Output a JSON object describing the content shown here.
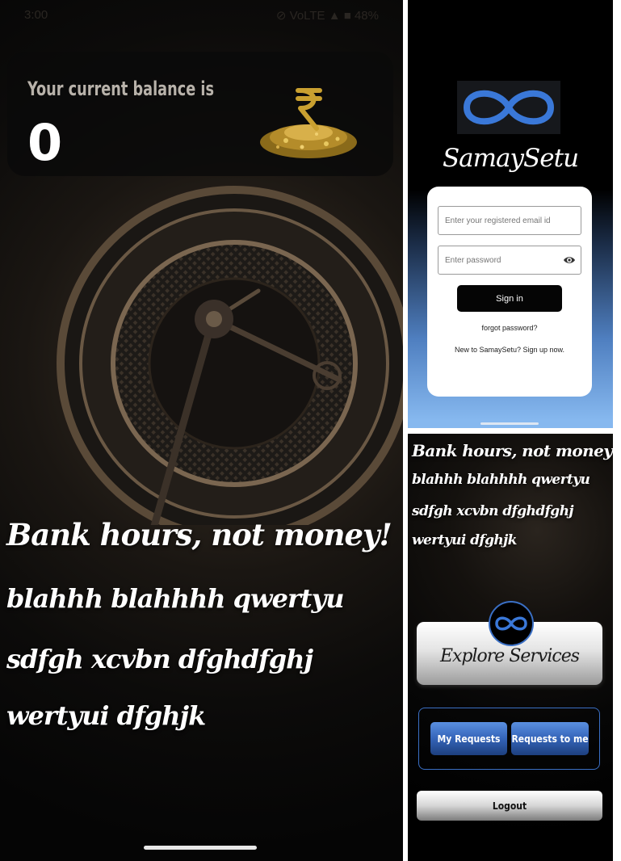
{
  "status_bar": {
    "time": "3:00",
    "indicators": "⊘ VoLTE ▲ ■ 48%"
  },
  "balance_screen": {
    "balance_label": "Your current balance is",
    "balance_value": "0",
    "tagline": [
      "Bank hours, not money!",
      "blahhh blahhhh qwertyu",
      "sdfgh xcvbn dfghdfghj",
      "wertyui dfghjk"
    ]
  },
  "login_screen": {
    "brand": "SamaySetu",
    "email_placeholder": "Enter your registered email id",
    "password_placeholder": "Enter password",
    "sign_in_label": "Sign in",
    "forgot_password": "forgot password?",
    "signup_prompt": "New to SamaySetu? Sign up now."
  },
  "home_screen": {
    "tagline": [
      "Bank hours, not money!",
      "blahhh blahhhh qwertyu",
      "sdfgh xcvbn dfghdfghj",
      "wertyui dfghjk"
    ],
    "explore_label": "Explore Services",
    "my_requests_label": "My Requests",
    "requests_to_me_label": "Requests to me",
    "logout_label": "Logout"
  },
  "icons": {
    "logo": "infinity-logo-icon",
    "coin": "rupee-coins-icon",
    "password_toggle": "eye-icon"
  },
  "colors": {
    "accent_blue": "#3a6fc4",
    "button_blue": "#3464b8",
    "login_gradient_end": "#86b8ef"
  }
}
